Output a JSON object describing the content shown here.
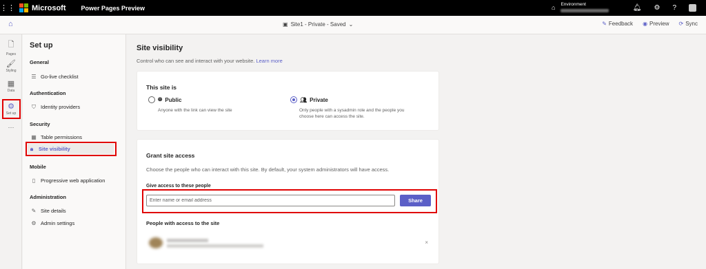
{
  "header": {
    "brand": "Microsoft",
    "product": "Power Pages Preview",
    "environment_label": "Environment",
    "icons": [
      "waffle-icon",
      "environment-icon",
      "bell-icon",
      "gear-icon",
      "help-icon",
      "avatar"
    ]
  },
  "commandbar": {
    "site_status": "Site1 - Private - Saved",
    "feedback": "Feedback",
    "preview": "Preview",
    "sync": "Sync"
  },
  "rail": {
    "items": [
      {
        "label": "Pages",
        "icon": "page-icon"
      },
      {
        "label": "Styling",
        "icon": "brush-icon"
      },
      {
        "label": "Data",
        "icon": "table-icon"
      },
      {
        "label": "Set up",
        "icon": "setup-icon",
        "active": true
      }
    ],
    "more": "···"
  },
  "setup": {
    "title": "Set up",
    "sections": [
      {
        "heading": "General",
        "items": [
          {
            "label": "Go-live checklist",
            "icon": "checklist-icon"
          }
        ]
      },
      {
        "heading": "Authentication",
        "items": [
          {
            "label": "Identity providers",
            "icon": "shield-icon"
          }
        ]
      },
      {
        "heading": "Security",
        "items": [
          {
            "label": "Table permissions",
            "icon": "table-icon"
          },
          {
            "label": "Site visibility",
            "icon": "lock-icon",
            "active": true
          }
        ]
      },
      {
        "heading": "Mobile",
        "items": [
          {
            "label": "Progressive web application",
            "icon": "phone-icon"
          }
        ]
      },
      {
        "heading": "Administration",
        "items": [
          {
            "label": "Site details",
            "icon": "edit-icon"
          },
          {
            "label": "Admin settings",
            "icon": "admin-icon"
          }
        ]
      }
    ]
  },
  "main": {
    "title": "Site visibility",
    "description": "Control who can see and interact with your website.",
    "learn_more": "Learn more",
    "visibility_card": {
      "title": "This site is",
      "public_label": "Public",
      "public_desc": "Anyone with the link can view the site",
      "private_label": "Private",
      "private_desc_1": "Only people with a sysadmin role and the people you",
      "private_desc_2": "choose here can access the site.",
      "selected": "Private"
    },
    "grant_card": {
      "title": "Grant site access",
      "description": "Choose the people who can interact with this site. By default, your system administrators will have access.",
      "field_label": "Give access to these people",
      "input_placeholder": "Enter name or email address",
      "share_label": "Share",
      "people_heading": "People with access to the site",
      "remove_glyph": "×"
    }
  },
  "colors": {
    "accent": "#5b5fc7",
    "highlight": "#e00000",
    "topbar": "#000000"
  }
}
